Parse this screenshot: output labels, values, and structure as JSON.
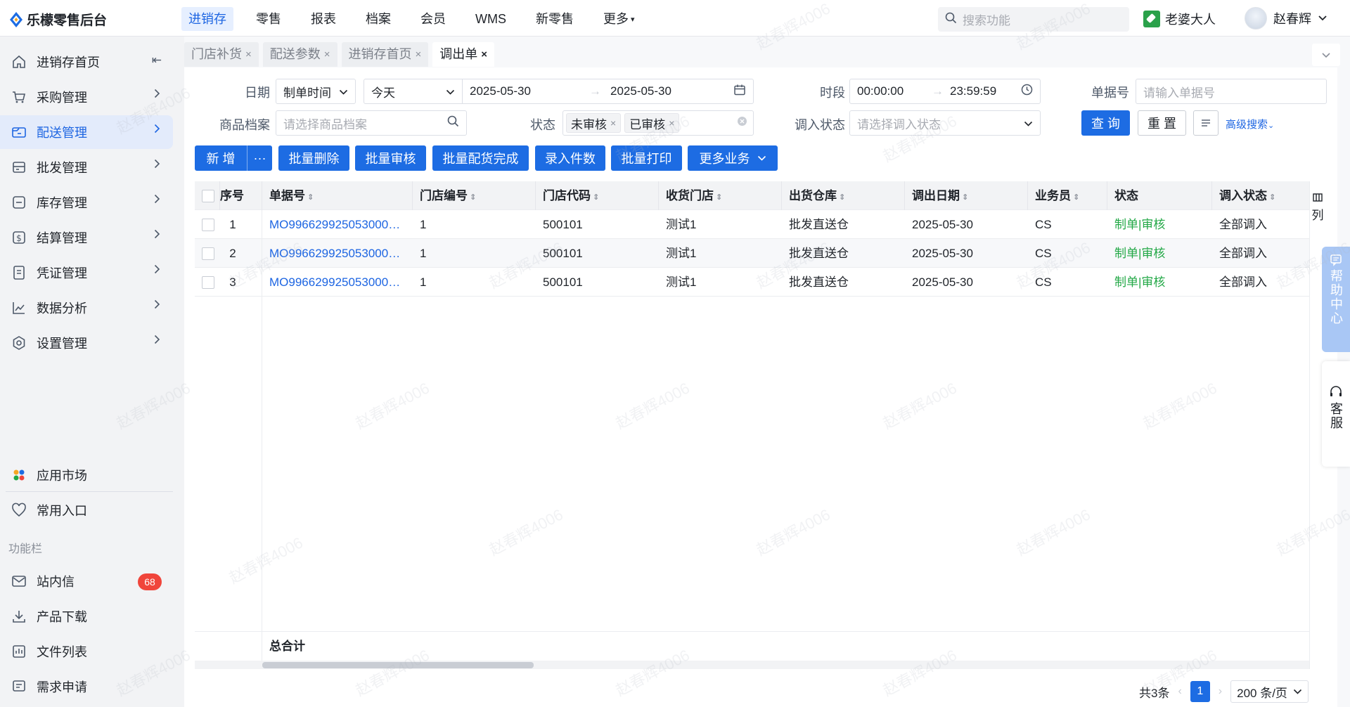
{
  "app": {
    "title": "乐檬零售后台"
  },
  "topnav": {
    "items": [
      "进销存",
      "零售",
      "报表",
      "档案",
      "会员",
      "WMS",
      "新零售",
      "更多"
    ],
    "active": "进销存"
  },
  "search": {
    "placeholder": "搜索功能"
  },
  "shop": {
    "name": "老婆大人"
  },
  "user": {
    "name": "赵春辉"
  },
  "sidebar": {
    "items": [
      {
        "label": "进销存首页",
        "icon": "home-icon"
      },
      {
        "label": "采购管理",
        "icon": "cart-icon"
      },
      {
        "label": "配送管理",
        "icon": "truck-icon"
      },
      {
        "label": "批发管理",
        "icon": "box-icon"
      },
      {
        "label": "库存管理",
        "icon": "inventory-icon"
      },
      {
        "label": "结算管理",
        "icon": "dollar-icon"
      },
      {
        "label": "凭证管理",
        "icon": "document-icon"
      },
      {
        "label": "数据分析",
        "icon": "chart-icon"
      },
      {
        "label": "设置管理",
        "icon": "settings-icon"
      }
    ],
    "active": "配送管理",
    "bottom": [
      {
        "label": "应用市场",
        "icon": "app-market-icon"
      },
      {
        "label": "常用入口",
        "icon": "heart-icon"
      }
    ],
    "section_title": "功能栏",
    "tools": [
      {
        "label": "站内信",
        "icon": "mail-icon",
        "badge": "68"
      },
      {
        "label": "产品下载",
        "icon": "download-icon"
      },
      {
        "label": "文件列表",
        "icon": "file-list-icon"
      },
      {
        "label": "需求申请",
        "icon": "request-icon"
      }
    ]
  },
  "tabs": [
    {
      "label": "门店补货",
      "active": false
    },
    {
      "label": "配送参数",
      "active": false
    },
    {
      "label": "进销存首页",
      "active": false
    },
    {
      "label": "调出单",
      "active": true
    }
  ],
  "filters": {
    "date_label": "日期",
    "date_type": "制单时间",
    "date_range": "今天",
    "date_start": "2025-05-30",
    "date_end": "2025-05-30",
    "time_label": "时段",
    "time_start": "00:00:00",
    "time_end": "23:59:59",
    "bill_no_label": "单据号",
    "bill_no_placeholder": "请输入单据号",
    "product_label": "商品档案",
    "product_placeholder": "请选择商品档案",
    "status_label": "状态",
    "status_tags": [
      "未审核",
      "已审核"
    ],
    "in_status_label": "调入状态",
    "in_status_placeholder": "请选择调入状态",
    "query_label": "查 询",
    "reset_label": "重 置",
    "advanced_label": "高级搜索"
  },
  "actions": {
    "new_label": "新 增",
    "more_dots": "···",
    "buttons": [
      "批量删除",
      "批量审核",
      "批量配货完成",
      "录入件数",
      "批量打印"
    ],
    "more_label": "更多业务"
  },
  "table": {
    "columns": [
      "序号",
      "单据号",
      "门店编号",
      "门店代码",
      "收货门店",
      "出货仓库",
      "调出日期",
      "业务员",
      "状态",
      "调入状态"
    ],
    "rows": [
      {
        "seq": "1",
        "bill_no": "MO996629925053000…",
        "store_no": "1",
        "store_code": "500101",
        "recv_store": "测试1",
        "warehouse": "批发直送仓",
        "date": "2025-05-30",
        "clerk": "CS",
        "status": "制单|审核",
        "in_status": "全部调入"
      },
      {
        "seq": "2",
        "bill_no": "MO996629925053000…",
        "store_no": "1",
        "store_code": "500101",
        "recv_store": "测试1",
        "warehouse": "批发直送仓",
        "date": "2025-05-30",
        "clerk": "CS",
        "status": "制单|审核",
        "in_status": "全部调入"
      },
      {
        "seq": "3",
        "bill_no": "MO996629925053000…",
        "store_no": "1",
        "store_code": "500101",
        "recv_store": "测试1",
        "warehouse": "批发直送仓",
        "date": "2025-05-30",
        "clerk": "CS",
        "status": "制单|审核",
        "in_status": "全部调入"
      }
    ],
    "total_label": "总合计",
    "column_setting_label": "列"
  },
  "pagination": {
    "total_text": "共3条",
    "current_page": "1",
    "page_size": "200 条/页"
  },
  "floating": {
    "help_label": "帮助中心",
    "service_label": "客服"
  },
  "watermark": "赵春辉4006",
  "colors": {
    "accent": "#1d6ce3",
    "sidebar_bg": "#f2f3f5",
    "status_green": "#22a846",
    "badge_red": "#f0453b"
  }
}
